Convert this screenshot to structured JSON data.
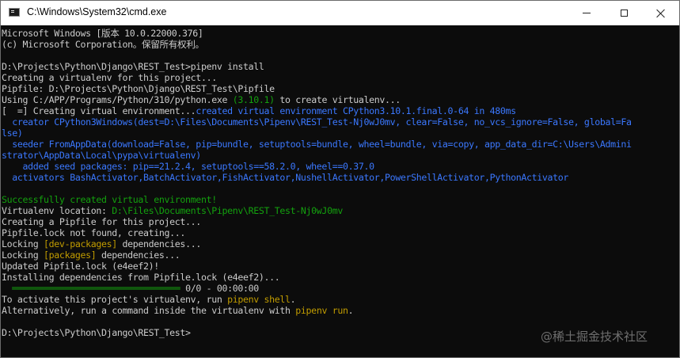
{
  "window": {
    "title": "C:\\Windows\\System32\\cmd.exe",
    "minimize_icon": "minimize-icon",
    "maximize_icon": "maximize-icon",
    "close_icon": "close-icon"
  },
  "colors": {
    "background": "#0c0c0c",
    "text": "#cccccc",
    "green": "#13a10e",
    "blue": "#3b78ff",
    "yellow": "#c19c00"
  },
  "console": {
    "lines": [
      [
        {
          "t": "Microsoft Windows [版本 10.0.22000.376]",
          "c": "white"
        }
      ],
      [
        {
          "t": "(c) Microsoft Corporation。保留所有权利。",
          "c": "white"
        }
      ],
      [
        {
          "t": "",
          "c": "white"
        }
      ],
      [
        {
          "t": "D:\\Projects\\Python\\Django\\REST_Test>pipenv install",
          "c": "white"
        }
      ],
      [
        {
          "t": "Creating a virtualenv for this project...",
          "c": "white"
        }
      ],
      [
        {
          "t": "Pipfile: D:\\Projects\\Python\\Django\\REST_Test\\Pipfile",
          "c": "white"
        }
      ],
      [
        {
          "t": "Using C:/APP/Programs/Python/310/python.exe ",
          "c": "white"
        },
        {
          "t": "(3.10.1)",
          "c": "green"
        },
        {
          "t": " to create virtualenv...",
          "c": "white"
        }
      ],
      [
        {
          "t": "[  =] Creating virtual environment...",
          "c": "white"
        },
        {
          "t": "created virtual environment CPython3.10.1.final.0-64 in 480ms",
          "c": "blue"
        }
      ],
      [
        {
          "t": "  creator CPython3Windows(dest=D:\\Files\\Documents\\Pipenv\\REST_Test-Nj0wJ0mv, clear=False, no_vcs_ignore=False, global=Fa",
          "c": "blue"
        }
      ],
      [
        {
          "t": "lse)",
          "c": "blue"
        }
      ],
      [
        {
          "t": "  seeder FromAppData(download=False, pip=bundle, setuptools=bundle, wheel=bundle, via=copy, app_data_dir=C:\\Users\\Admini",
          "c": "blue"
        }
      ],
      [
        {
          "t": "strator\\AppData\\Local\\pypa\\virtualenv)",
          "c": "blue"
        }
      ],
      [
        {
          "t": "    added seed packages: pip==21.2.4, setuptools==58.2.0, wheel==0.37.0",
          "c": "blue"
        }
      ],
      [
        {
          "t": "  activators BashActivator,BatchActivator,FishActivator,NushellActivator,PowerShellActivator,PythonActivator",
          "c": "blue"
        }
      ],
      [
        {
          "t": "",
          "c": "white"
        }
      ],
      [
        {
          "t": "Successfully created virtual environment!",
          "c": "green"
        }
      ],
      [
        {
          "t": "Virtualenv location: ",
          "c": "white"
        },
        {
          "t": "D:\\Files\\Documents\\Pipenv\\REST_Test-Nj0wJ0mv",
          "c": "green"
        }
      ],
      [
        {
          "t": "Creating a Pipfile for this project...",
          "c": "white"
        }
      ],
      [
        {
          "t": "Pipfile.lock not found, creating...",
          "c": "white"
        }
      ],
      [
        {
          "t": "Locking ",
          "c": "white"
        },
        {
          "t": "[dev-packages]",
          "c": "yellow"
        },
        {
          "t": " dependencies...",
          "c": "white"
        }
      ],
      [
        {
          "t": "Locking ",
          "c": "white"
        },
        {
          "t": "[packages]",
          "c": "yellow"
        },
        {
          "t": " dependencies...",
          "c": "white"
        }
      ],
      [
        {
          "t": "Updated Pipfile.lock (e4eef2)!",
          "c": "white"
        }
      ],
      [
        {
          "t": "Installing dependencies from Pipfile.lock (e4eef2)...",
          "c": "white"
        }
      ],
      [
        {
          "t": "  ════════════════════════════════ ",
          "c": "bar"
        },
        {
          "t": "0/0 - 00:00:00",
          "c": "white"
        }
      ],
      [
        {
          "t": "To activate this project's virtualenv, run ",
          "c": "white"
        },
        {
          "t": "pipenv shell",
          "c": "yellow"
        },
        {
          "t": ".",
          "c": "white"
        }
      ],
      [
        {
          "t": "Alternatively, run a command inside the virtualenv with ",
          "c": "white"
        },
        {
          "t": "pipenv run",
          "c": "yellow"
        },
        {
          "t": ".",
          "c": "white"
        }
      ],
      [
        {
          "t": "",
          "c": "white"
        }
      ],
      [
        {
          "t": "D:\\Projects\\Python\\Django\\REST_Test>",
          "c": "white"
        }
      ]
    ]
  },
  "watermark": "@稀土掘金技术社区"
}
